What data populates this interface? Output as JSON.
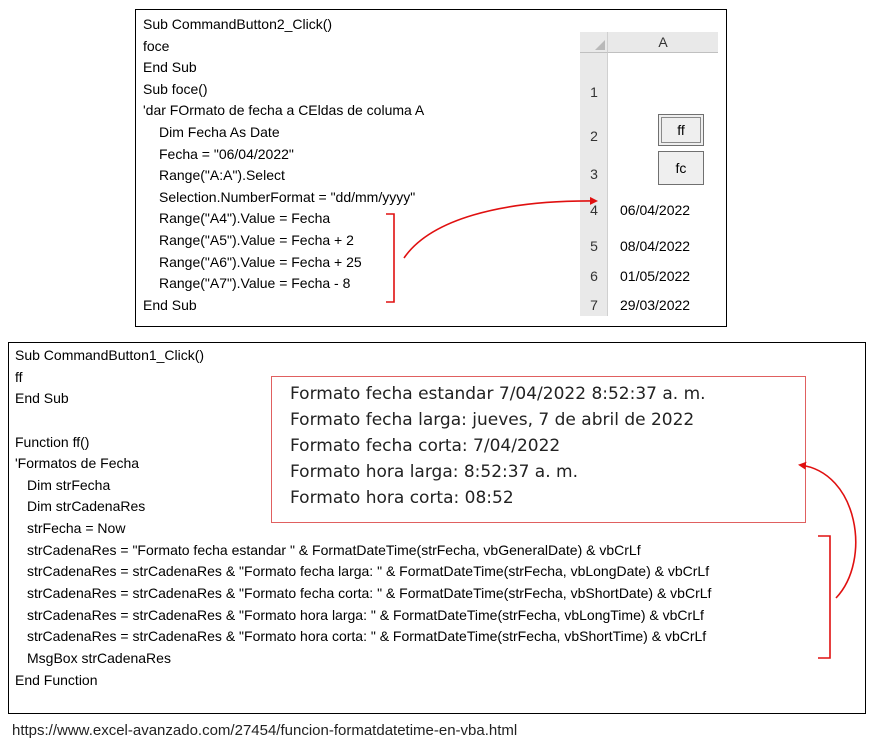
{
  "top_code": {
    "lines": [
      "Sub CommandButton2_Click()",
      "foce",
      "End Sub",
      "Sub foce()",
      "'dar FOrmato de fecha a CEldas de columa A",
      "Dim Fecha As Date",
      "Fecha = \"06/04/2022\"",
      "Range(\"A:A\").Select",
      "Selection.NumberFormat = \"dd/mm/yyyy\"",
      "Range(\"A4\").Value = Fecha",
      "Range(\"A5\").Value = Fecha + 2",
      "Range(\"A6\").Value = Fecha + 25",
      "Range(\"A7\").Value = Fecha - 8",
      "End Sub"
    ]
  },
  "sheet": {
    "column_header": "A",
    "rows": [
      {
        "num": "1",
        "value": ""
      },
      {
        "num": "2",
        "value": ""
      },
      {
        "num": "3",
        "value": ""
      },
      {
        "num": "4",
        "value": "06/04/2022"
      },
      {
        "num": "5",
        "value": "08/04/2022"
      },
      {
        "num": "6",
        "value": "01/05/2022"
      },
      {
        "num": "7",
        "value": "29/03/2022"
      }
    ],
    "buttons": {
      "ff": "ff",
      "fc": "fc"
    }
  },
  "bottom_code": {
    "lines": [
      "Sub CommandButton1_Click()",
      "ff",
      "End Sub",
      "",
      "Function ff()",
      "'Formatos de Fecha",
      "Dim strFecha",
      "Dim strCadenaRes",
      "strFecha = Now",
      "strCadenaRes = \"Formato fecha estandar \" & FormatDateTime(strFecha, vbGeneralDate) & vbCrLf",
      "strCadenaRes = strCadenaRes & \"Formato fecha larga: \" & FormatDateTime(strFecha, vbLongDate) & vbCrLf",
      "strCadenaRes = strCadenaRes & \"Formato fecha corta: \" & FormatDateTime(strFecha, vbShortDate) & vbCrLf",
      "strCadenaRes = strCadenaRes & \"Formato hora larga: \" & FormatDateTime(strFecha, vbLongTime) & vbCrLf",
      "strCadenaRes = strCadenaRes & \"Formato hora corta: \" & FormatDateTime(strFecha, vbShortTime) & vbCrLf",
      "MsgBox strCadenaRes",
      "End Function"
    ]
  },
  "msgbox": {
    "lines": [
      "Formato fecha estandar 7/04/2022 8:52:37 a. m.",
      "Formato fecha larga: jueves, 7 de abril de 2022",
      "Formato fecha corta: 7/04/2022",
      "Formato hora larga: 8:52:37 a. m.",
      "Formato hora corta: 08:52"
    ]
  },
  "footer": {
    "url": "https://www.excel-avanzado.com/27454/funcion-formatdatetime-en-vba.html"
  },
  "colors": {
    "annotation_red": "#e01010",
    "box_border": "#e06060"
  }
}
